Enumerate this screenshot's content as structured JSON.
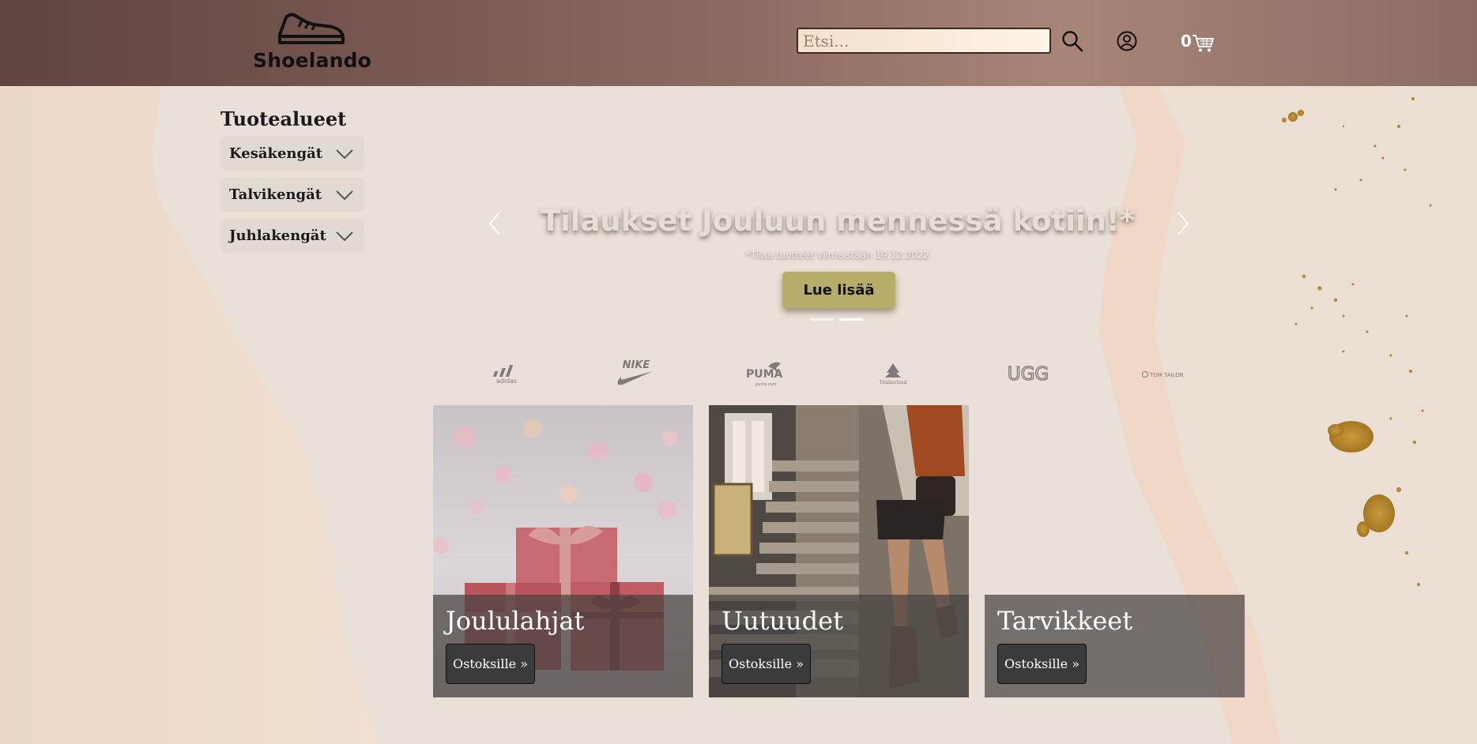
{
  "header": {
    "logo_text": "Shoelando",
    "search": {
      "placeholder": "Etsi..."
    },
    "cart_count": "0"
  },
  "sidebar": {
    "title": "Tuotealueet",
    "items": [
      {
        "label": "Kesäkengät"
      },
      {
        "label": "Talvikengät"
      },
      {
        "label": "Juhlakengät"
      }
    ]
  },
  "hero": {
    "title": "Tilaukset Jouluun mennessä kotiin!*",
    "subtitle": "*Tilaa tuotteet viimeistään 19.12.2022",
    "button_label": "Lue lisää",
    "slides": 2,
    "active_slide": 2
  },
  "brands": [
    {
      "name": "adidas"
    },
    {
      "name": "NIKE"
    },
    {
      "name": "PUMA"
    },
    {
      "name": "Timberland"
    },
    {
      "name": "UGG"
    },
    {
      "name": "TOM TAILOR"
    }
  ],
  "cards": [
    {
      "title": "Joululahjat",
      "button_label": "Ostoksille »"
    },
    {
      "title": "Uutuudet",
      "button_label": "Ostoksille »"
    },
    {
      "title": "Tarvikkeet",
      "button_label": "Ostoksille »"
    }
  ],
  "colors": {
    "header_brown": "#7a5a54",
    "accent_button": "#b6ad6a",
    "page_background": "#ebe3da"
  }
}
